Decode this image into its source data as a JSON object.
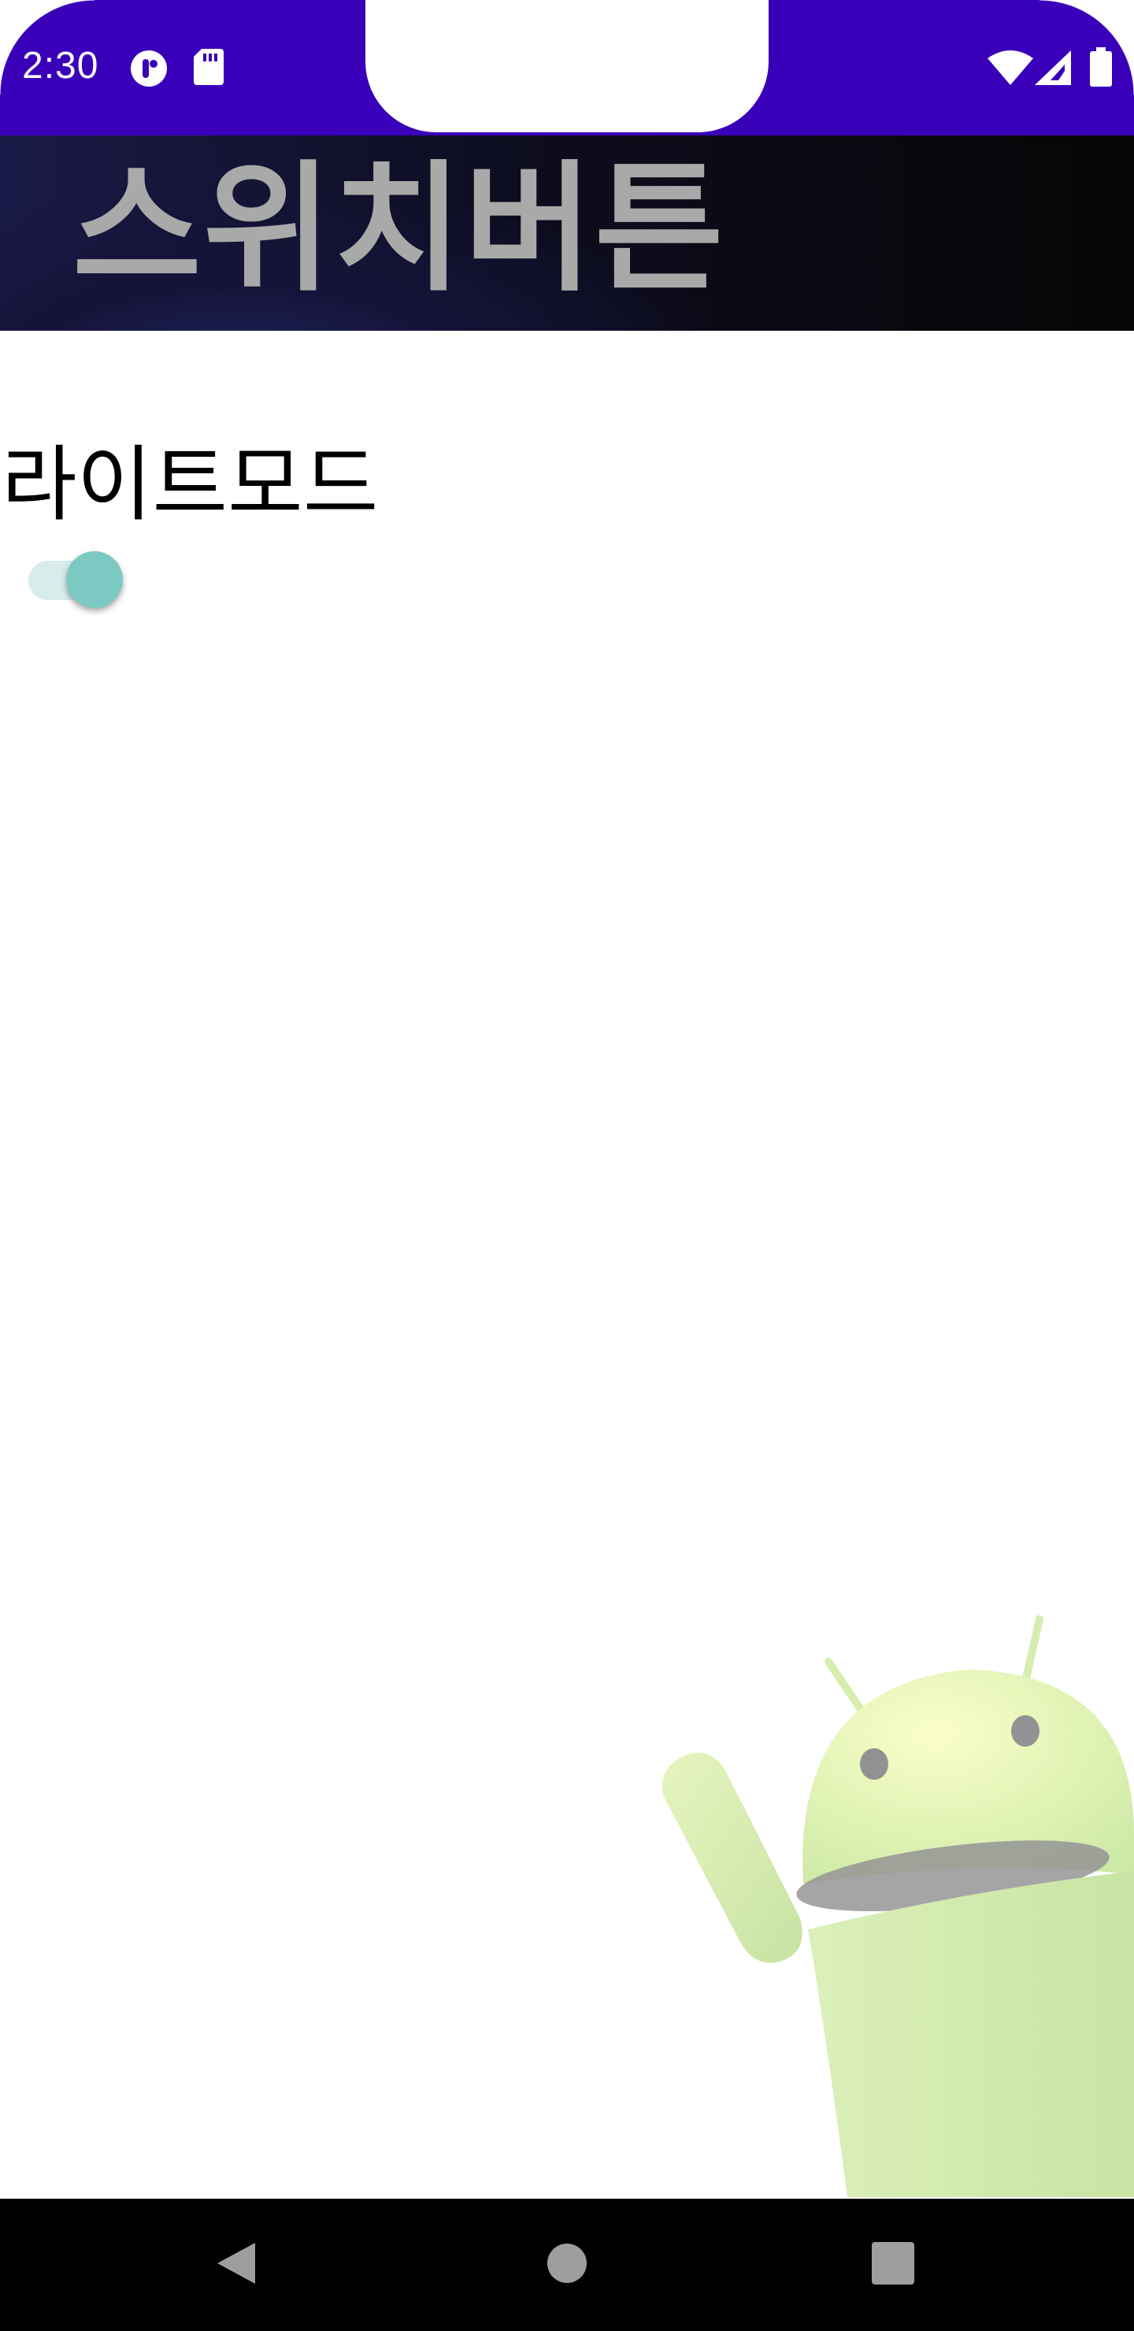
{
  "status_bar": {
    "time": "2:30",
    "icons": [
      "data-saver-icon",
      "sd-card-icon",
      "wifi-icon",
      "cell-signal-icon",
      "battery-icon"
    ],
    "background_color": "#3a00b9"
  },
  "app_bar": {
    "title": "스위치버튼",
    "title_color": "#a9a9a9"
  },
  "main": {
    "mode_label": "라이트모드",
    "switch": {
      "checked": true,
      "thumb_color": "#7cc9c3",
      "track_color": "#d9ecec"
    }
  },
  "decoration": {
    "mascot": "android-mascot-image"
  },
  "nav_bar": {
    "buttons": [
      "back-icon",
      "home-icon",
      "recents-icon"
    ]
  }
}
